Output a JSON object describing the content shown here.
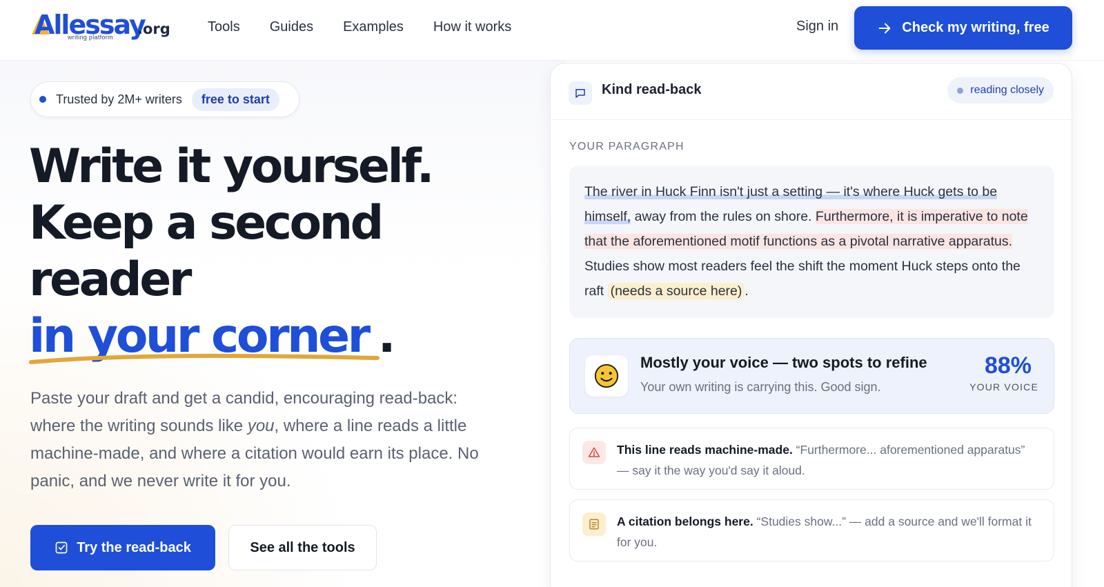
{
  "header": {
    "logo": {
      "name": "Allessay",
      "tld": ".org",
      "tagline": "writing platform"
    },
    "nav": [
      "Tools",
      "Guides",
      "Examples",
      "How it works"
    ],
    "sign_in": "Sign in",
    "cta": "Check my writing, free",
    "brand_color": "#1f4fd8"
  },
  "hero": {
    "trust_text": "Trusted by 2M+ writers",
    "trust_badge": "free to start",
    "headline_line1": "Write it yourself.",
    "headline_line2": "Keep a second",
    "headline_line3": "reader",
    "headline_highlight": "in your corner",
    "headline_end": ".",
    "sub_part1": "Paste your draft and get a candid, encouraging read-back: where the writing sounds like ",
    "sub_em": "you",
    "sub_part2": ", where a line reads a little machine-made, and where a citation would earn its place. No panic, and we never write it for you.",
    "primary_button": "Try the read-back",
    "secondary_button": "See all the tools",
    "underline_color": "#e2a63b"
  },
  "card": {
    "icon": "chat-bubble-icon",
    "title": "Kind read-back",
    "status": "reading closely",
    "section_label": "YOUR PARAGRAPH",
    "paragraph": {
      "seg1": "The river in Huck Finn isn't just a setting — it's where Huck gets to be himself,",
      "seg2": " away from the rules on shore. ",
      "seg3": "Furthermore, it is imperative to note that the aforementioned motif functions as a pivotal narrative apparatus.",
      "seg4": " Studies show most readers feel the shift the moment Huck steps onto the raft ",
      "seg5": "(needs a source here)",
      "seg6": "."
    },
    "voice": {
      "icon": "smiley-face-icon",
      "title": "Mostly your voice — two spots to refine",
      "subtitle": "Your own writing is carrying this. Good sign.",
      "percent": "88%",
      "percent_label": "YOUR VOICE"
    },
    "notes": [
      {
        "icon": "warning-triangle-icon",
        "bold": "This line reads machine-made.",
        "text": " “Furthermore... aforementioned apparatus” — say it the way you'd say it aloud."
      },
      {
        "icon": "document-lines-icon",
        "bold": "A citation belongs here.",
        "text": " “Studies show...” — add a source and we'll format it for you."
      }
    ]
  }
}
